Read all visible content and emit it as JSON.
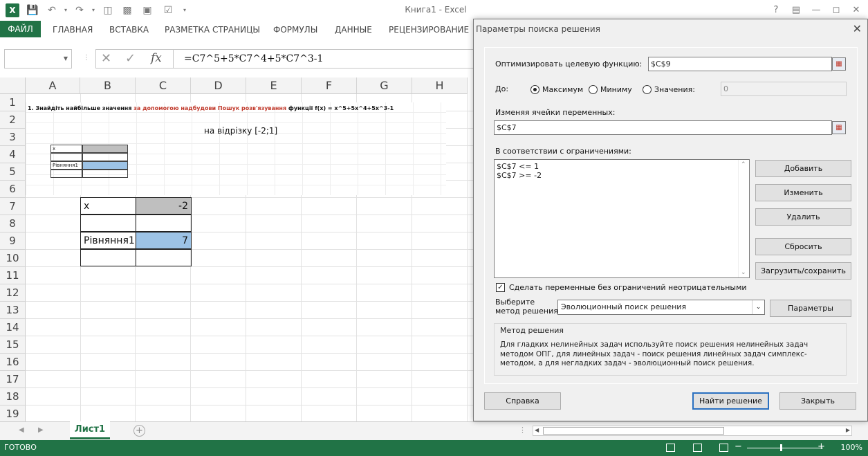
{
  "window": {
    "title": "Книга1 - Excel",
    "help": "?"
  },
  "ribbon": {
    "tabs": [
      "ФАЙЛ",
      "ГЛАВНАЯ",
      "ВСТАВКА",
      "РАЗМЕТКА СТРАНИЦЫ",
      "ФОРМУЛЫ",
      "ДАННЫЕ",
      "РЕЦЕНЗИРОВАНИЕ"
    ]
  },
  "formula_bar": {
    "name_box": "",
    "fx": "fx",
    "formula": "=C7^5+5*C7^4+5*C7^3-1"
  },
  "grid": {
    "columns": [
      "A",
      "B",
      "C",
      "D",
      "E",
      "F",
      "G",
      "H"
    ],
    "rows": [
      "1",
      "2",
      "3",
      "4",
      "5",
      "6",
      "7",
      "8",
      "9",
      "10",
      "11",
      "12",
      "13",
      "14",
      "15",
      "16",
      "17",
      "18",
      "19"
    ],
    "task_prefix": "1. Знайдіть найбільше значення ",
    "task_red": "за допомогою надбудови Пошук розв'язування",
    "task_suffix": "  функції f(x) = x^5+5x^4+5x^3-1",
    "interval": "на відрізку [-2;1]",
    "mini_x": "x",
    "mini_eq": "Рівняння1",
    "b7": "x",
    "c7": "-2",
    "b9": "Рівняння1",
    "c9": "7"
  },
  "sheet_tabs": {
    "active": "Лист1"
  },
  "status": {
    "text": "ГОТОВО",
    "zoom": "100%"
  },
  "dialog": {
    "title": "Параметры поиска решения",
    "objective_label": "Оптимизировать целевую функцию:",
    "objective_value": "$C$9",
    "to_label": "До:",
    "radio_max": "Максимум",
    "radio_min": "Миниму",
    "radio_value": "Значения:",
    "value_field": "0",
    "by_changing_label": "Изменяя ячейки переменных:",
    "by_changing_value": "$C$7",
    "constraints_label": "В соответствии с ограничениями:",
    "constraints": [
      "$C$7 <= 1",
      "$C$7 >= -2"
    ],
    "btn_add": "Добавить",
    "btn_change": "Изменить",
    "btn_delete": "Удалить",
    "btn_reset": "Сбросить",
    "btn_load": "Загрузить/сохранить",
    "unconstrained_label": "Сделать переменные без ограничений неотрицательными",
    "method_label_1": "Выберите",
    "method_label_2": "метод решения:",
    "method_value": "Эволюционный поиск решения",
    "btn_options": "Параметры",
    "desc_title": "Метод решения",
    "desc_text": "Для гладких нелинейных задач используйте поиск решения нелинейных задач методом ОПГ, для линейных задач - поиск решения линейных задач симплекс-методом, а для негладких задач - эволюционный поиск решения.",
    "btn_help": "Справка",
    "btn_solve": "Найти решение",
    "btn_close": "Закрыть"
  },
  "colors": {
    "excel_green": "#217346",
    "selected_gray": "#bfbfbf",
    "selected_blue": "#9dc3e6"
  }
}
